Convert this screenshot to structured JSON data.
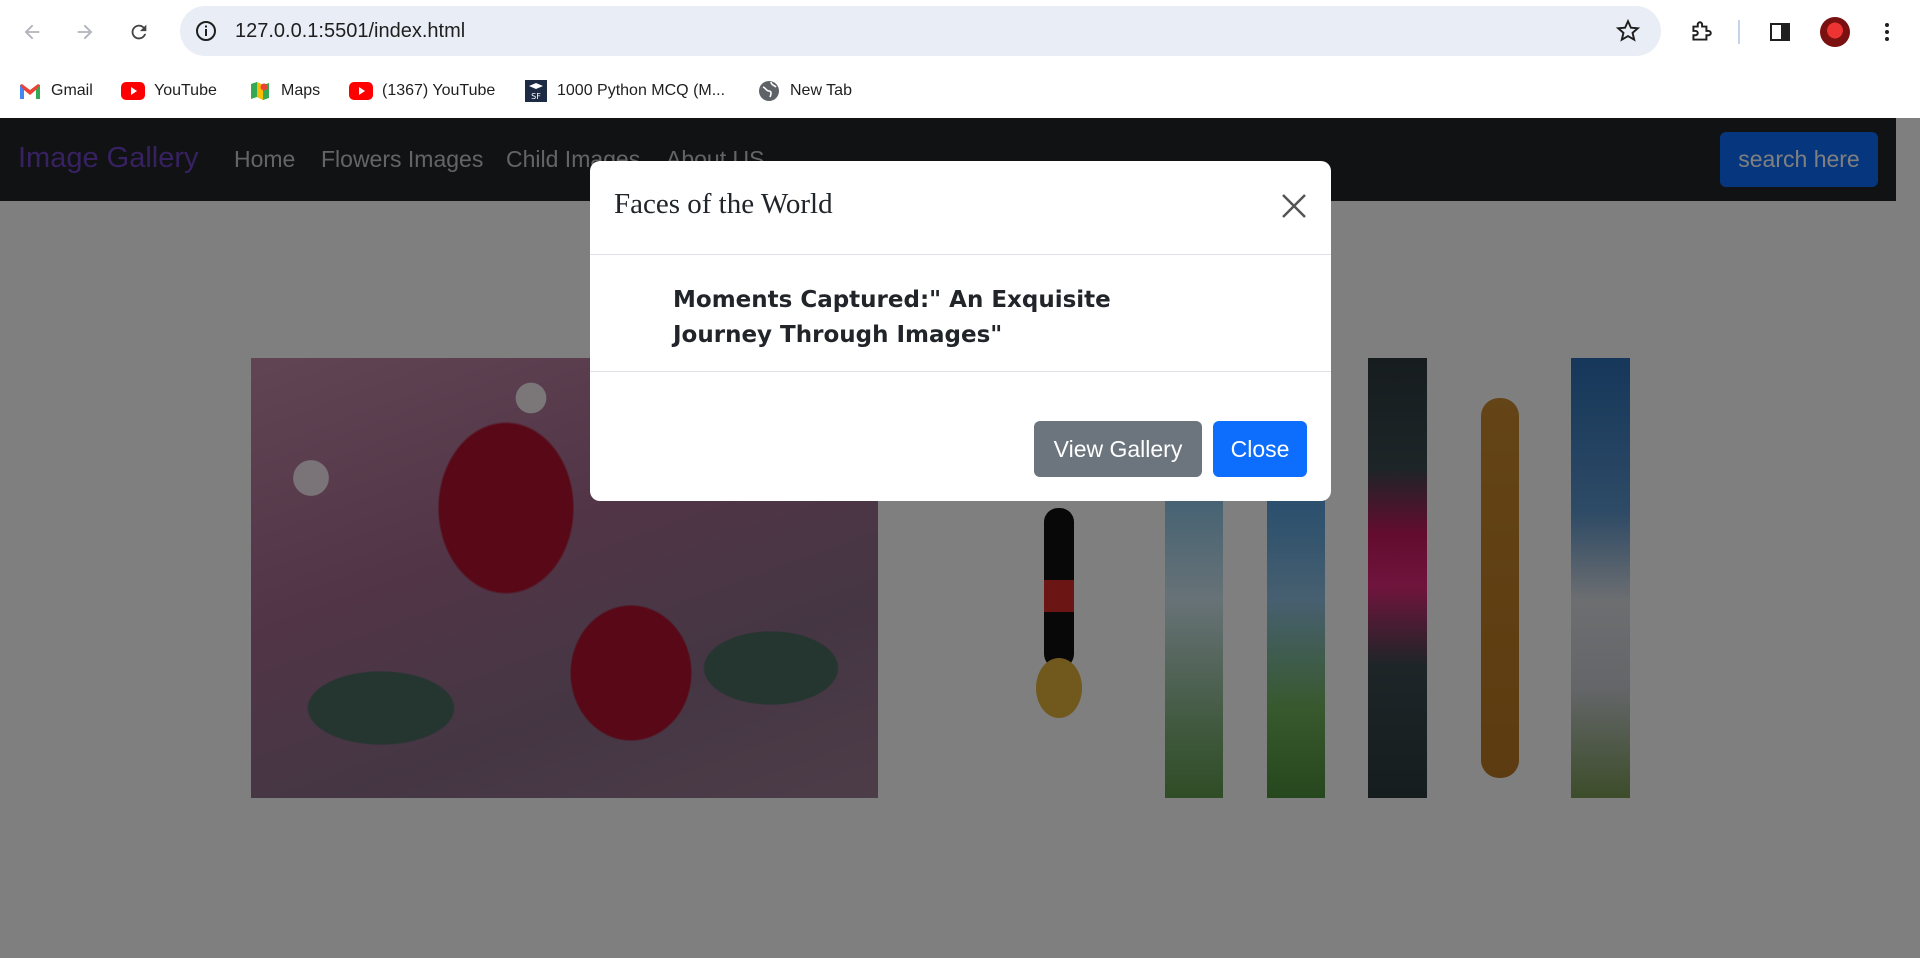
{
  "browser": {
    "url": "127.0.0.1:5501/index.html",
    "bookmarks": [
      {
        "label": "Gmail",
        "icon": "gmail-icon"
      },
      {
        "label": "YouTube",
        "icon": "youtube-icon"
      },
      {
        "label": "Maps",
        "icon": "maps-icon"
      },
      {
        "label": "(1367) YouTube",
        "icon": "youtube-icon"
      },
      {
        "label": "1000 Python MCQ (M...",
        "icon": "sf-icon"
      },
      {
        "label": "New Tab",
        "icon": "globe-icon"
      }
    ]
  },
  "navbar": {
    "brand": "Image Gallery",
    "links": [
      "Home",
      "Flowers Images",
      "Child Images",
      "About US"
    ],
    "search_label": "search here"
  },
  "modal": {
    "title": "Faces of the World",
    "body": "Moments Captured:\" An Exquisite Journey Through Images\"",
    "view_gallery_label": "View Gallery",
    "close_label": "Close"
  },
  "colors": {
    "brand": "#6f42c1",
    "primary": "#0d6efd",
    "secondary": "#6c757d",
    "navbar_bg": "#212529"
  }
}
